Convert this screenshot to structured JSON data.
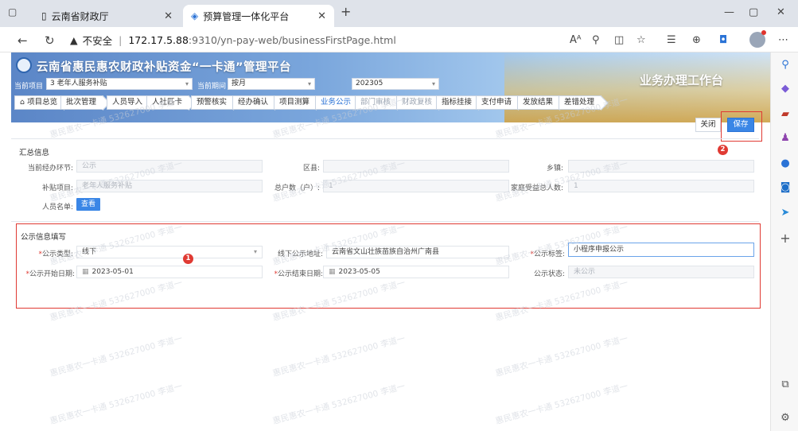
{
  "browser": {
    "tabs": [
      {
        "title": "云南省财政厅",
        "active": false
      },
      {
        "title": "预算管理一体化平台",
        "active": true
      }
    ],
    "url": {
      "insecure_label": "不安全",
      "host": "172.17.5.88",
      "port_path": ":9310/yn-pay-web/businessFirstPage.html"
    }
  },
  "app": {
    "title": "云南省惠民惠农财政补贴资金“一卡通”管理平台",
    "workbench": "业务办理工作台",
    "filters": [
      {
        "label": "当前项目",
        "value": "3 老年人服务补贴"
      },
      {
        "label": "当前期间",
        "value": "按月"
      },
      {
        "label": "",
        "value": "202305"
      }
    ]
  },
  "steps": [
    {
      "label": "项目总览",
      "state": "normal"
    },
    {
      "label": "批次管理",
      "state": "normal"
    },
    {
      "label": "人员导入",
      "state": "normal"
    },
    {
      "label": "人社匹卡",
      "state": "normal"
    },
    {
      "label": "预警核实",
      "state": "normal"
    },
    {
      "label": "经办确认",
      "state": "normal"
    },
    {
      "label": "项目测算",
      "state": "normal"
    },
    {
      "label": "业务公示",
      "state": "current"
    },
    {
      "label": "部门审核",
      "state": "disabled"
    },
    {
      "label": "财政复核",
      "state": "disabled"
    },
    {
      "label": "指标挂接",
      "state": "normal"
    },
    {
      "label": "支付申请",
      "state": "normal"
    },
    {
      "label": "发放结果",
      "state": "normal"
    },
    {
      "label": "差错处理",
      "state": "normal"
    }
  ],
  "actions": {
    "close": "关闭",
    "save": "保存"
  },
  "badges": {
    "first": "1",
    "second": "2"
  },
  "summary": {
    "title": "汇总信息",
    "fields": [
      {
        "label": "当前经办环节:",
        "value": "公示"
      },
      {
        "label": "区县:",
        "value": ""
      },
      {
        "label": "乡镇:",
        "value": ""
      },
      {
        "label": "补贴项目:",
        "value": "老年人服务补贴"
      },
      {
        "label": "总户数（户）:",
        "value": "1"
      },
      {
        "label": "家庭受益总人数:",
        "value": "1"
      }
    ],
    "personnel_label": "人员名单:",
    "view_button": "查看"
  },
  "publicity": {
    "title": "公示信息填写",
    "type_label": "公示类型:",
    "type_value": "线下",
    "address_label": "线下公示地址:",
    "address_value": "云南省文山壮族苗族自治州广南县",
    "tag_label": "公示标签:",
    "tag_value": "小程序申报公示",
    "start_label": "公示开始日期:",
    "start_value": "2023-05-01",
    "end_label": "公示结束日期:",
    "end_value": "2023-05-05",
    "status_label": "公示状态:",
    "status_value": "未公示"
  },
  "watermark": "惠民惠农一卡通 532627000 李道一"
}
